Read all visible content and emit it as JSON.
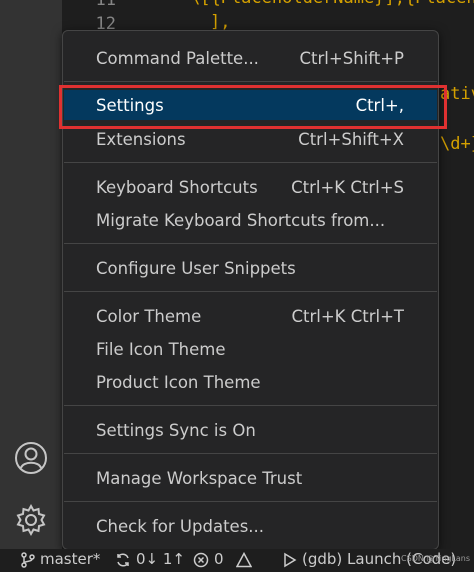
{
  "editor": {
    "line_numbers": [
      "11",
      "12"
    ],
    "code_fragments": {
      "line11": "\\[{PlaceholderName}],{Placeho",
      "line12": "],",
      "right1": "ativ",
      "right2": "\\d+}"
    }
  },
  "menu": {
    "items": [
      {
        "label": "Command Palette...",
        "shortcut": "Ctrl+Shift+P"
      },
      {
        "label": "Settings",
        "shortcut": "Ctrl+,"
      },
      {
        "label": "Extensions",
        "shortcut": "Ctrl+Shift+X"
      },
      {
        "label": "Keyboard Shortcuts",
        "shortcut": "Ctrl+K Ctrl+S"
      },
      {
        "label": "Migrate Keyboard Shortcuts from...",
        "shortcut": ""
      },
      {
        "label": "Configure User Snippets",
        "shortcut": ""
      },
      {
        "label": "Color Theme",
        "shortcut": "Ctrl+K Ctrl+T"
      },
      {
        "label": "File Icon Theme",
        "shortcut": ""
      },
      {
        "label": "Product Icon Theme",
        "shortcut": ""
      },
      {
        "label": "Settings Sync is On",
        "shortcut": ""
      },
      {
        "label": "Manage Workspace Trust",
        "shortcut": ""
      },
      {
        "label": "Check for Updates...",
        "shortcut": ""
      }
    ]
  },
  "status_bar": {
    "branch": "master*",
    "sync": "0↓ 1↑",
    "problems": "0",
    "launch": "(gdb) Launch (Code)"
  },
  "watermark": "CSDN @TingLans",
  "colors": {
    "menu_bg": "#252526",
    "selected_bg": "#04395e",
    "highlight_border": "#e03131",
    "activity_bar": "#333333"
  },
  "icons": [
    "account-icon",
    "gear-icon",
    "source-control-icon",
    "sync-icon",
    "error-icon",
    "debug-run-icon"
  ]
}
